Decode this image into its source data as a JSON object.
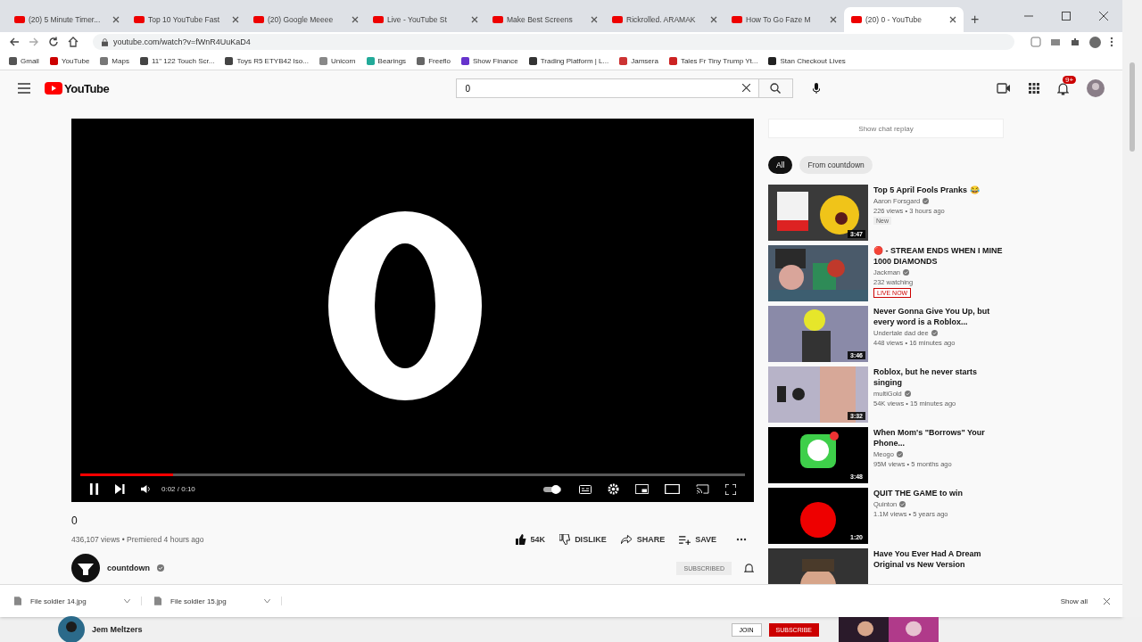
{
  "browser": {
    "tabs": [
      {
        "title": "(20) 5 Minute Timer...",
        "selected": false
      },
      {
        "title": "Top 10 YouTube Fast",
        "selected": false
      },
      {
        "title": "(20) Google Meeee",
        "selected": false
      },
      {
        "title": "Live - YouTube St",
        "selected": false
      },
      {
        "title": "Make Best Screens",
        "selected": false
      },
      {
        "title": "Rickrolled. ARAMAK",
        "selected": false
      },
      {
        "title": "How To Go Faze M",
        "selected": false
      },
      {
        "title": "(20) 0 - YouTube",
        "selected": true
      }
    ],
    "new_tab": "+",
    "address": "youtube.com/watch?v=fWnR4UuKaD4",
    "bookmarks": [
      "Gmail",
      "YouTube",
      "Maps",
      "11\" 122 Touch Scr...",
      "Toys R5 ETYB42 Iso...",
      "Unicorn",
      "Bearings",
      "Freeflo",
      "Show Finance",
      "Trading Platform | L...",
      "Jamsera",
      "Tales Fr Tiny Trump Yt...",
      "Stan Checkout Lives"
    ]
  },
  "header": {
    "logo": "YouTube",
    "search": {
      "value": "0"
    },
    "notifications": "9+"
  },
  "player": {
    "level": 0.14,
    "time": "0:02 / 0:10"
  },
  "video": {
    "title": "0",
    "meta": "436,107 views • Premiered 4 hours ago",
    "actions": [
      {
        "kind": "like",
        "label": "54K"
      },
      {
        "kind": "dislike",
        "label": "DISLIKE"
      },
      {
        "kind": "share",
        "label": "SHARE"
      },
      {
        "kind": "save",
        "label": "SAVE"
      }
    ],
    "channel": "countdown",
    "subscribe": "SUBSCRIBED"
  },
  "sidebar": {
    "chat": "Show chat replay",
    "chips": [
      {
        "label": "All",
        "selected": true
      },
      {
        "label": "From countdown",
        "selected": false
      }
    ],
    "videos": [
      {
        "title": "Top 5 April Fools Pranks 😂",
        "channel": "Aaron Forsgard",
        "meta": "226 views • 3 hours ago",
        "badge": {
          "kind": "new",
          "label": "New"
        },
        "duration": "3:47"
      },
      {
        "title": "🔴 - STREAM ENDS WHEN I MINE 1000 DIAMONDS",
        "channel": "Jackman",
        "meta": "232 watching",
        "badge": {
          "kind": "live",
          "label": "LIVE NOW"
        }
      },
      {
        "title": "Never Gonna Give You Up, but every word is a Roblox...",
        "channel": "Undertale dad dee",
        "meta": "448 views • 16 minutes ago",
        "duration": "3:46"
      },
      {
        "title": "Roblox, but he never starts singing",
        "channel": "multiGold",
        "meta": "54K views • 15 minutes ago",
        "duration": "3:32"
      },
      {
        "title": "When Mom's \"Borrows\" Your Phone...",
        "channel": "Meogo",
        "meta": "95M views • 5 months ago",
        "duration": "3:48"
      },
      {
        "title": "QUIT THE GAME to win",
        "channel": "Quinton",
        "meta": "1.1M views • 5 years ago",
        "duration": "1:20"
      },
      {
        "title": "Have You Ever Had A Dream Original vs New Version"
      }
    ]
  },
  "downloads": {
    "files": [
      "File soldier 14.jpg",
      "File soldier 15.jpg"
    ],
    "show_all": "Show all"
  },
  "background_page": {
    "channel": "Jem Meltzers",
    "buttons": [
      "JOIN",
      "SUBSCRIBE"
    ]
  }
}
